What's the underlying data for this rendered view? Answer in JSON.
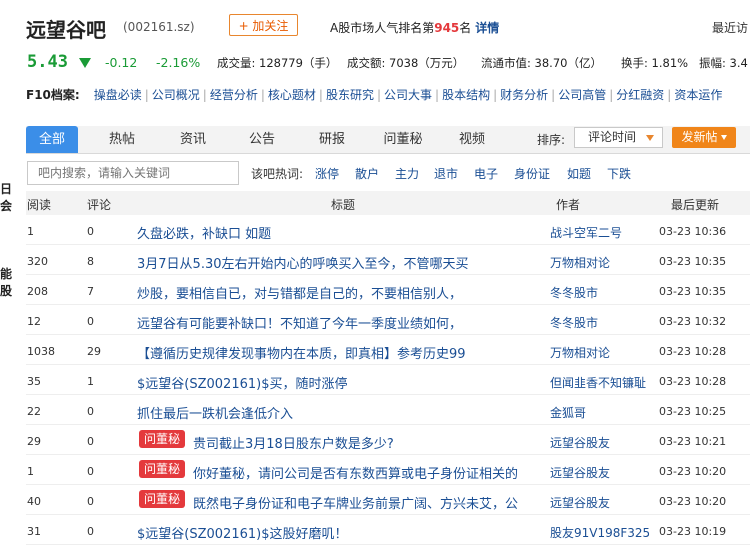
{
  "header": {
    "title": "远望谷吧",
    "code": "(002161.sz)",
    "follow_label": "+ 加关注",
    "rank_prefix": "A股市场人气排名第",
    "rank_number": "945",
    "rank_suffix": "名",
    "rank_detail": "详情",
    "recent": "最近访"
  },
  "quote": {
    "price": "5.43",
    "change": "-0.12",
    "change_pct": "-2.16%",
    "volume": "成交量: 128779（手）",
    "amount": "成交额: 7038（万元）",
    "float_cap": "流通市值: 38.70（亿）",
    "turnover": "换手: 1.81%",
    "amplitude": "振幅: 3.4"
  },
  "f10": {
    "label": "F10档案:",
    "items": [
      "操盘必读",
      "公司概况",
      "经营分析",
      "核心题材",
      "股东研究",
      "公司大事",
      "股本结构",
      "财务分析",
      "公司高管",
      "分红融资",
      "资本运作"
    ]
  },
  "left_decor": [
    "日",
    "会",
    "能",
    "股"
  ],
  "tabs": [
    "全部",
    "热帖",
    "资讯",
    "公告",
    "研报",
    "问董秘",
    "视频"
  ],
  "sort": {
    "label": "排序:",
    "selected": "评论时间"
  },
  "post_button": "发新帖",
  "search": {
    "placeholder": "吧内搜索，请输入关键词"
  },
  "hot": {
    "label": "该吧热词:",
    "words": [
      "涨停",
      "散户",
      "主力",
      "退市",
      "电子",
      "身份证",
      "如题",
      "下跌"
    ]
  },
  "columns": {
    "read": "阅读",
    "comment": "评论",
    "title": "标题",
    "author": "作者",
    "updated": "最后更新"
  },
  "badge_label": "问董秘",
  "rows": [
    {
      "read": "1",
      "comment": "0",
      "title": "久盘必跌，补缺口 如题",
      "author": "战斗空军二号",
      "time": "03-23  10:36",
      "badge": false
    },
    {
      "read": "320",
      "comment": "8",
      "title": "3月7日从5.30左右开始内心的呼唤买入至今，不管哪天买",
      "author": "万物相对论",
      "time": "03-23  10:35",
      "badge": false
    },
    {
      "read": "208",
      "comment": "7",
      "title": "炒股，要相信自已，对与错都是自己的，不要相信别人，",
      "author": "冬冬股市",
      "time": "03-23  10:35",
      "badge": false
    },
    {
      "read": "12",
      "comment": "0",
      "title": "远望谷有可能要补缺口！不知道了今年一季度业绩如何，",
      "author": "冬冬股市",
      "time": "03-23  10:32",
      "badge": false
    },
    {
      "read": "1038",
      "comment": "29",
      "title": "【遵循历史规律发现事物内在本质，即真相】参考历史99",
      "author": "万物相对论",
      "time": "03-23  10:28",
      "badge": false
    },
    {
      "read": "35",
      "comment": "1",
      "title": "$远望谷(SZ002161)$买，随时涨停",
      "author": "但闻韭香不知镰耻",
      "time": "03-23  10:28",
      "badge": false
    },
    {
      "read": "22",
      "comment": "0",
      "title": "抓住最后一跌机会逢低介入",
      "author": "金狐哥",
      "time": "03-23  10:25",
      "badge": false
    },
    {
      "read": "29",
      "comment": "0",
      "title": "贵司截止3月18日股东户数是多少?",
      "author": "远望谷股友",
      "time": "03-23  10:21",
      "badge": true
    },
    {
      "read": "1",
      "comment": "0",
      "title": "你好董秘，请问公司是否有东数西算或电子身份证相关的",
      "author": "远望谷股友",
      "time": "03-23  10:20",
      "badge": true
    },
    {
      "read": "40",
      "comment": "0",
      "title": "既然电子身份证和电子车牌业务前景广阔、方兴未艾，公",
      "author": "远望谷股友",
      "time": "03-23  10:20",
      "badge": true
    },
    {
      "read": "31",
      "comment": "0",
      "title": "$远望谷(SZ002161)$这股好磨叽！",
      "author": "股友91V198F325",
      "time": "03-23  10:19",
      "badge": false
    }
  ]
}
